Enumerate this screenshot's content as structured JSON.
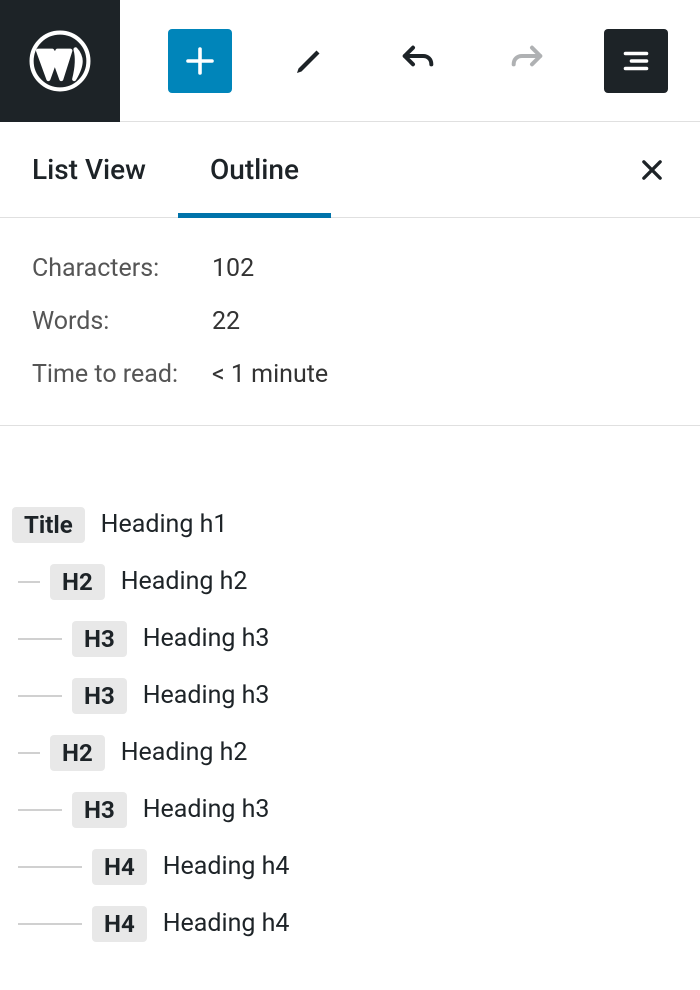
{
  "tabs": {
    "list_view": "List View",
    "outline": "Outline"
  },
  "stats": {
    "characters_label": "Characters:",
    "characters_value": "102",
    "words_label": "Words:",
    "words_value": "22",
    "time_label": "Time to read:",
    "time_value": "< 1 minute"
  },
  "outline": {
    "items": [
      {
        "badge": "Title",
        "label": "Heading h1",
        "level": 0
      },
      {
        "badge": "H2",
        "label": "Heading h2",
        "level": 1
      },
      {
        "badge": "H3",
        "label": "Heading h3",
        "level": 2
      },
      {
        "badge": "H3",
        "label": "Heading h3",
        "level": 2
      },
      {
        "badge": "H2",
        "label": "Heading h2",
        "level": 1
      },
      {
        "badge": "H3",
        "label": "Heading h3",
        "level": 2
      },
      {
        "badge": "H4",
        "label": "Heading h4",
        "level": 3
      },
      {
        "badge": "H4",
        "label": "Heading h4",
        "level": 3
      }
    ]
  }
}
